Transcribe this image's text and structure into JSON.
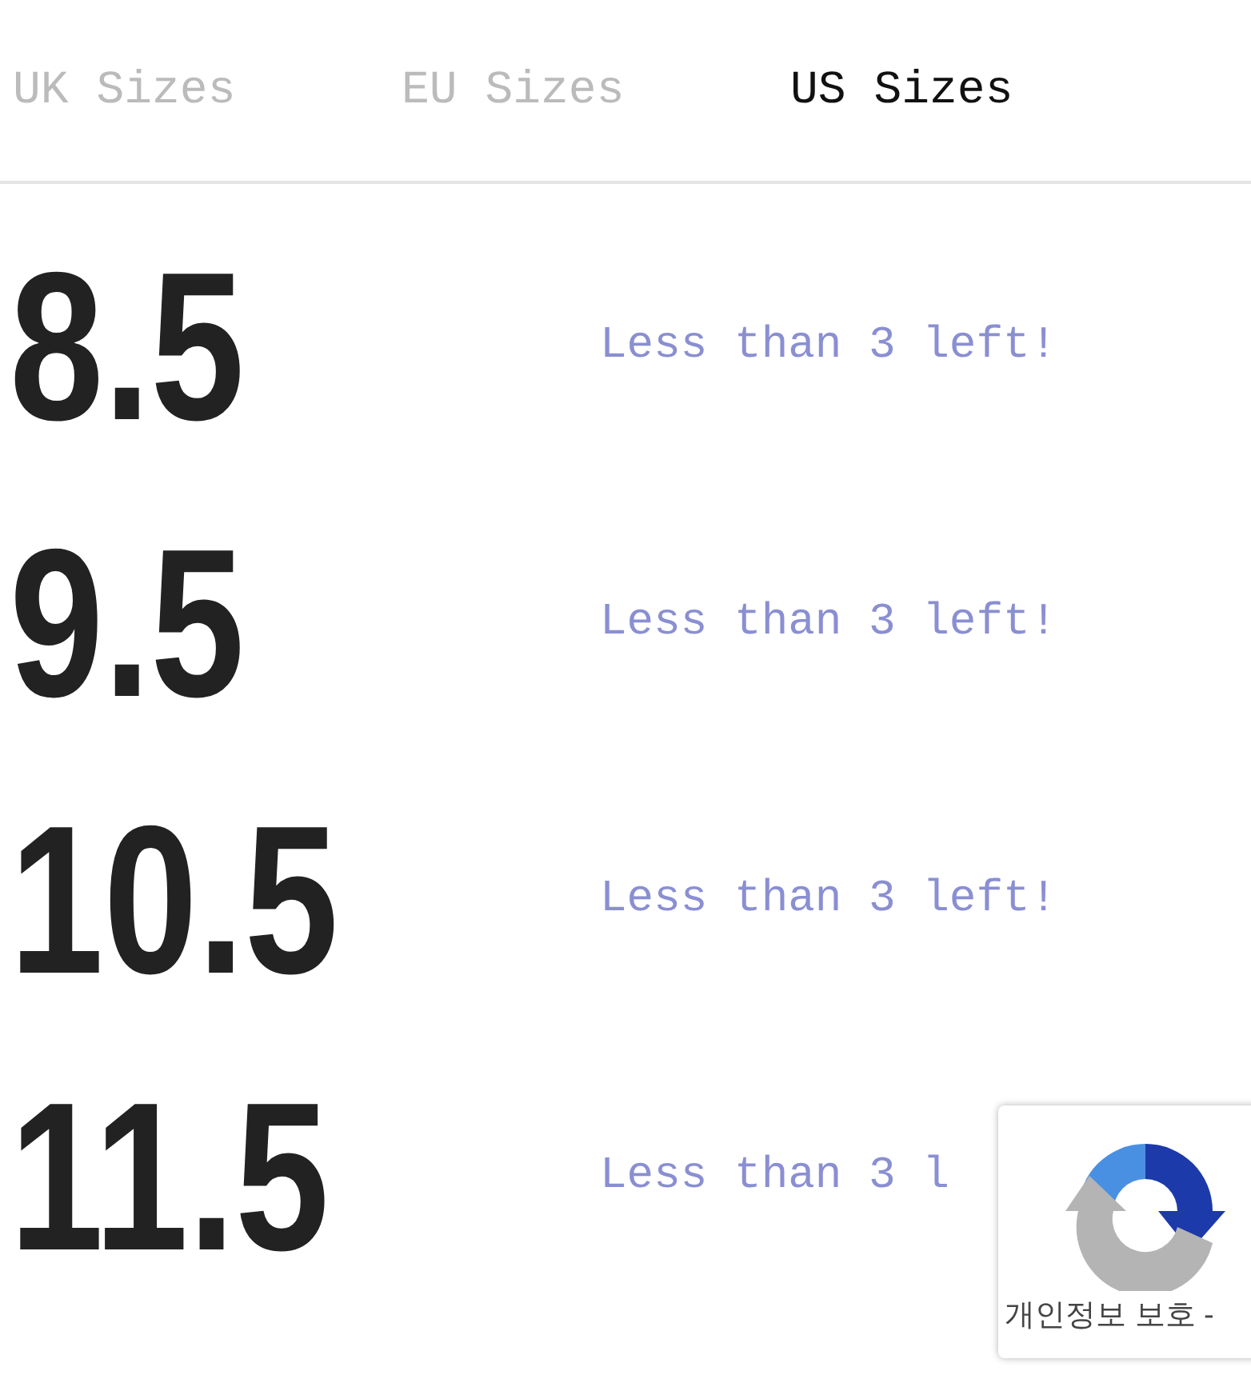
{
  "tabs": [
    {
      "label": "UK Sizes",
      "selected": false
    },
    {
      "label": "EU Sizes",
      "selected": false
    },
    {
      "label": "US Sizes",
      "selected": true
    }
  ],
  "sizes": [
    {
      "size": "8.5",
      "stock": "Less than 3 left!"
    },
    {
      "size": "9.5",
      "stock": "Less than 3 left!"
    },
    {
      "size": "10.5",
      "stock": "Less than 3 left!"
    },
    {
      "size": "11.5",
      "stock": "Less than 3 l"
    }
  ],
  "recaptcha_badge": {
    "text": "개인정보 보호 -"
  }
}
